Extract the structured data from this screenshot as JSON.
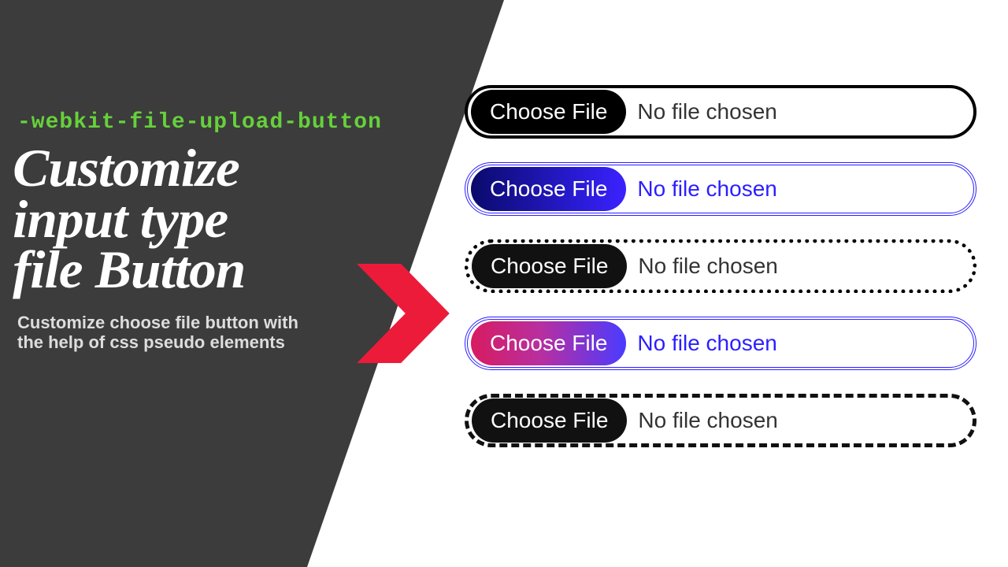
{
  "left": {
    "overline": "-webkit-file-upload-button",
    "title_line1": "Customize",
    "title_line2": "input type",
    "title_line3": "file Button",
    "subtitle": "Customize choose file button with the help of css pseudo elements"
  },
  "colors": {
    "panel": "#3c3c3c",
    "accent_green": "#66d13b",
    "arrow": "#ed1b3a",
    "blue": "#2b1fff"
  },
  "rows": [
    {
      "variant": "v1",
      "button_label": "Choose File",
      "status": "No file chosen"
    },
    {
      "variant": "v2",
      "button_label": "Choose File",
      "status": "No file chosen"
    },
    {
      "variant": "v3",
      "button_label": "Choose File",
      "status": "No file chosen"
    },
    {
      "variant": "v4",
      "button_label": "Choose File",
      "status": "No file chosen"
    },
    {
      "variant": "v5",
      "button_label": "Choose File",
      "status": "No file chosen"
    }
  ]
}
